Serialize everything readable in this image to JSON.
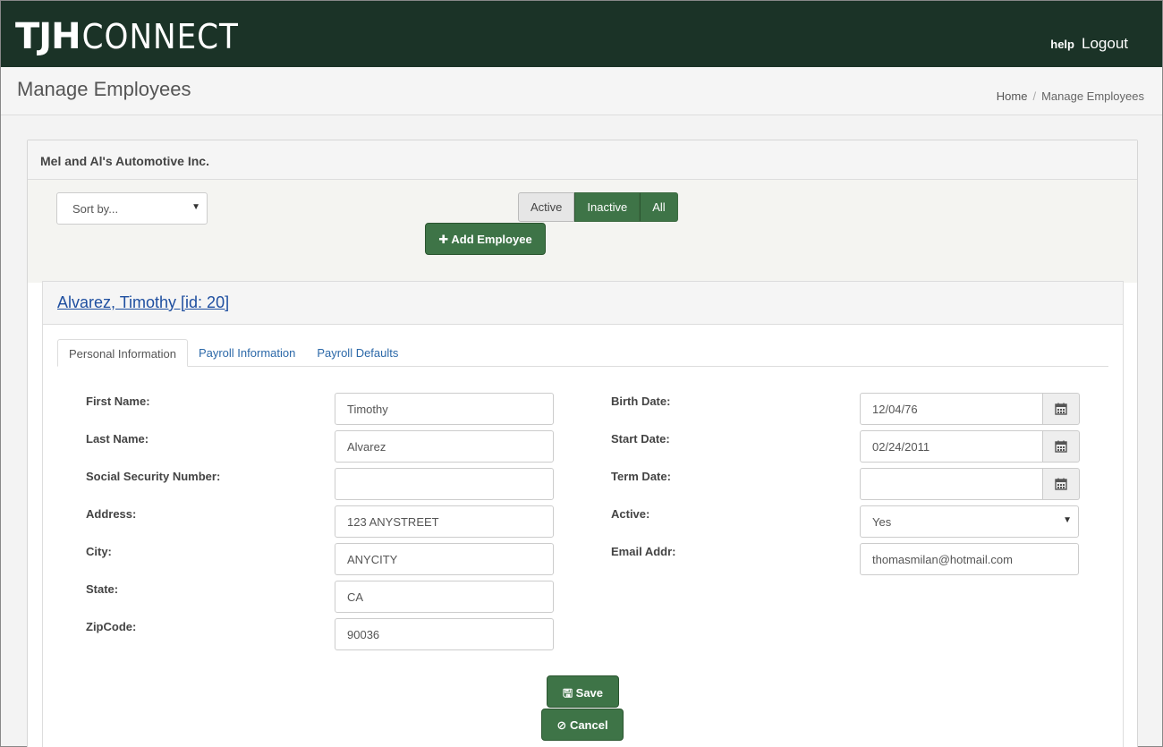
{
  "header": {
    "logo_bold": "TJH",
    "logo_light": "CONNECT",
    "help_label": "help",
    "logout_label": "Logout"
  },
  "page": {
    "title": "Manage Employees",
    "breadcrumb": [
      "Home",
      "Manage Employees"
    ]
  },
  "company": {
    "name": "Mel and Al's Automotive Inc."
  },
  "toolbar": {
    "sort_placeholder": "Sort by...",
    "filters": [
      "Active",
      "Inactive",
      "All"
    ],
    "selected_filter": "Active",
    "add_employee_label": "Add Employee"
  },
  "employee": {
    "heading": "Alvarez, Timothy [id: 20]",
    "tabs": [
      "Personal Information",
      "Payroll Information",
      "Payroll Defaults"
    ],
    "active_tab": "Personal Information",
    "left_fields": [
      {
        "label": "First Name:",
        "value": "Timothy"
      },
      {
        "label": "Last Name:",
        "value": "Alvarez"
      },
      {
        "label": "Social Security Number:",
        "value": ""
      },
      {
        "label": "Address:",
        "value": "123 ANYSTREET"
      },
      {
        "label": "City:",
        "value": "ANYCITY"
      },
      {
        "label": "State:",
        "value": "CA"
      },
      {
        "label": "ZipCode:",
        "value": "90036"
      }
    ],
    "right_fields": [
      {
        "label": "Birth Date:",
        "value": "12/04/76"
      },
      {
        "label": "Start Date:",
        "value": "02/24/2011"
      },
      {
        "label": "Term Date:",
        "value": ""
      },
      {
        "label": "Active:",
        "value": "Yes"
      },
      {
        "label": "Email Addr:",
        "value": "thomasmilan@hotmail.com"
      }
    ],
    "save_label": "Save",
    "cancel_label": "Cancel"
  },
  "colors": {
    "header_bg": "#1b3327",
    "accent_green": "#3e7447",
    "link_blue": "#1f4fa0"
  }
}
